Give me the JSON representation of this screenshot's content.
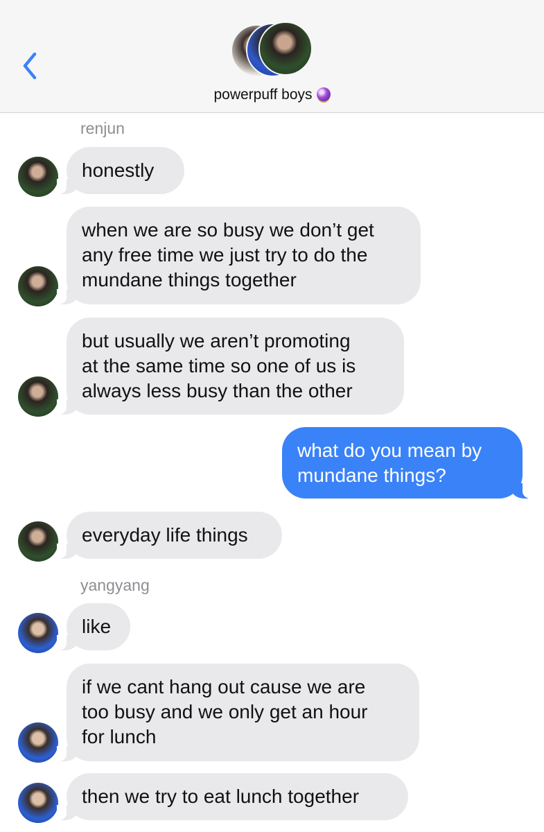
{
  "header": {
    "title": "powerpuff boys",
    "title_emoji": "crystal-ball-icon",
    "back_icon": "chevron-left-icon"
  },
  "colors": {
    "accent": "#3a82f7",
    "incoming_bubble": "#e9e9eb",
    "sender_label": "#8e8e93",
    "header_bg": "#f6f6f7"
  },
  "messages": {
    "renjun_label": "renjun",
    "m1": "honestly",
    "m2": "when we are so busy we don’t get\nany free time we just try to do the\nmundane things together",
    "m3": "but usually we aren’t promoting\nat the same time so one of us is\nalways less busy than the other",
    "m4": "what do you mean by\nmundane things?",
    "m5": "everyday life things",
    "yangyang_label": "yangyang",
    "m6": "like",
    "m7": "if we cant hang out cause we are\ntoo busy and we only get an hour\nfor lunch",
    "m8": "then we try to eat lunch together"
  }
}
